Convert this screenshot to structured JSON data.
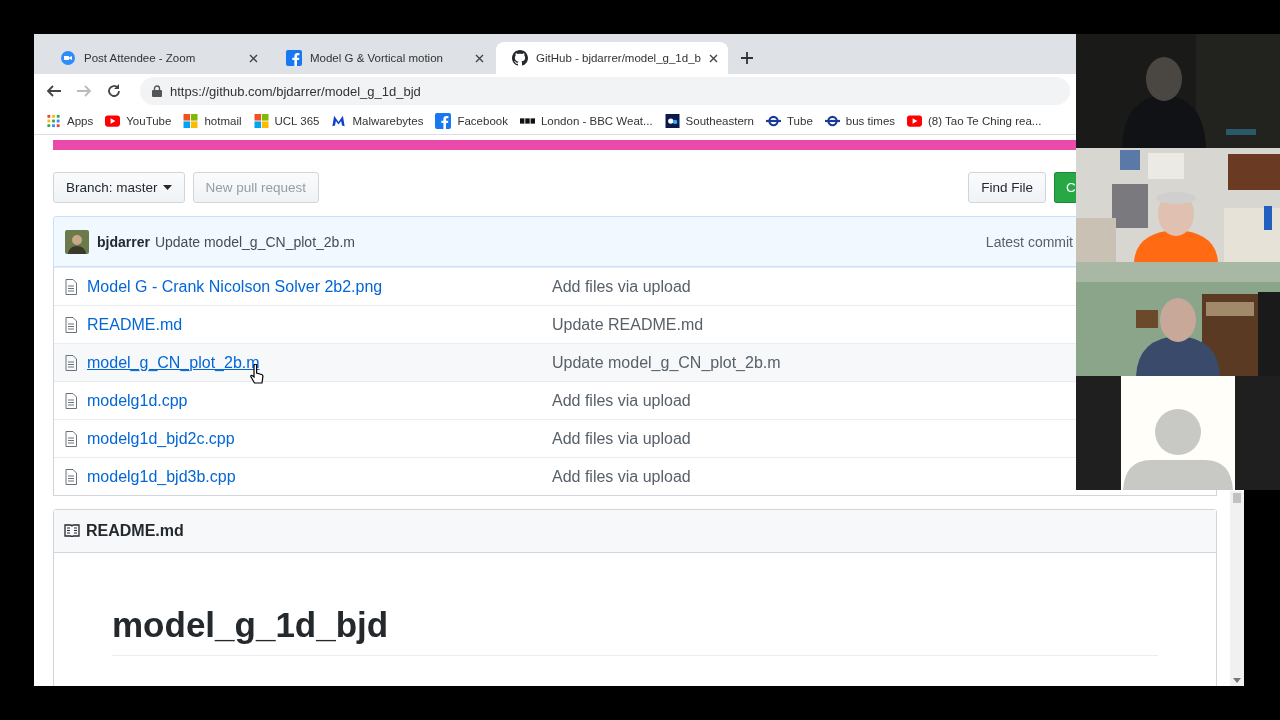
{
  "tabs": [
    {
      "title": "Post Attendee - Zoom",
      "kind": "zoom",
      "selected": false
    },
    {
      "title": "Model G & Vortical motion",
      "kind": "facebook",
      "selected": false
    },
    {
      "title": "GitHub - bjdarrer/model_g_1d_b",
      "kind": "github",
      "selected": true
    }
  ],
  "address": "https://github.com/bjdarrer/model_g_1d_bjd",
  "bookmarks": [
    {
      "label": "Apps",
      "kind": "apps"
    },
    {
      "label": "YouTube",
      "kind": "youtube"
    },
    {
      "label": "hotmail",
      "kind": "squares"
    },
    {
      "label": "UCL 365",
      "kind": "squares"
    },
    {
      "label": "Malwarebytes",
      "kind": "malware"
    },
    {
      "label": "Facebook",
      "kind": "facebook"
    },
    {
      "label": "London - BBC Weat...",
      "kind": "bbc"
    },
    {
      "label": "Southeastern",
      "kind": "se"
    },
    {
      "label": "Tube",
      "kind": "roundel"
    },
    {
      "label": "bus times",
      "kind": "roundel"
    },
    {
      "label": "(8) Tao Te Ching rea...",
      "kind": "youtube"
    }
  ],
  "branch_button": "Branch: master",
  "new_pull_request": {
    "label": "New pull request",
    "disabled": true
  },
  "find_file": "Find File",
  "clone_button": "C",
  "commit": {
    "author": "bjdarrer",
    "message": "Update model_g_CN_plot_2b.m",
    "latest": "Latest commit"
  },
  "files": [
    {
      "name": "Model G - Crank Nicolson Solver 2b2.png",
      "message": "Add files via upload",
      "hovered": false
    },
    {
      "name": "README.md",
      "message": "Update README.md",
      "hovered": false
    },
    {
      "name": "model_g_CN_plot_2b.m",
      "message": "Update model_g_CN_plot_2b.m",
      "hovered": true
    },
    {
      "name": "modelg1d.cpp",
      "message": "Add files via upload",
      "hovered": false
    },
    {
      "name": "modelg1d_bjd2c.cpp",
      "message": "Add files via upload",
      "hovered": false
    },
    {
      "name": "modelg1d_bjd3b.cpp",
      "message": "Add files via upload",
      "hovered": false
    }
  ],
  "readme": {
    "title": "README.md",
    "heading": "model_g_1d_bjd"
  },
  "video_tiles": [
    {
      "kind": "picture"
    },
    {
      "kind": "picture"
    },
    {
      "kind": "picture"
    },
    {
      "kind": "avatar"
    }
  ]
}
